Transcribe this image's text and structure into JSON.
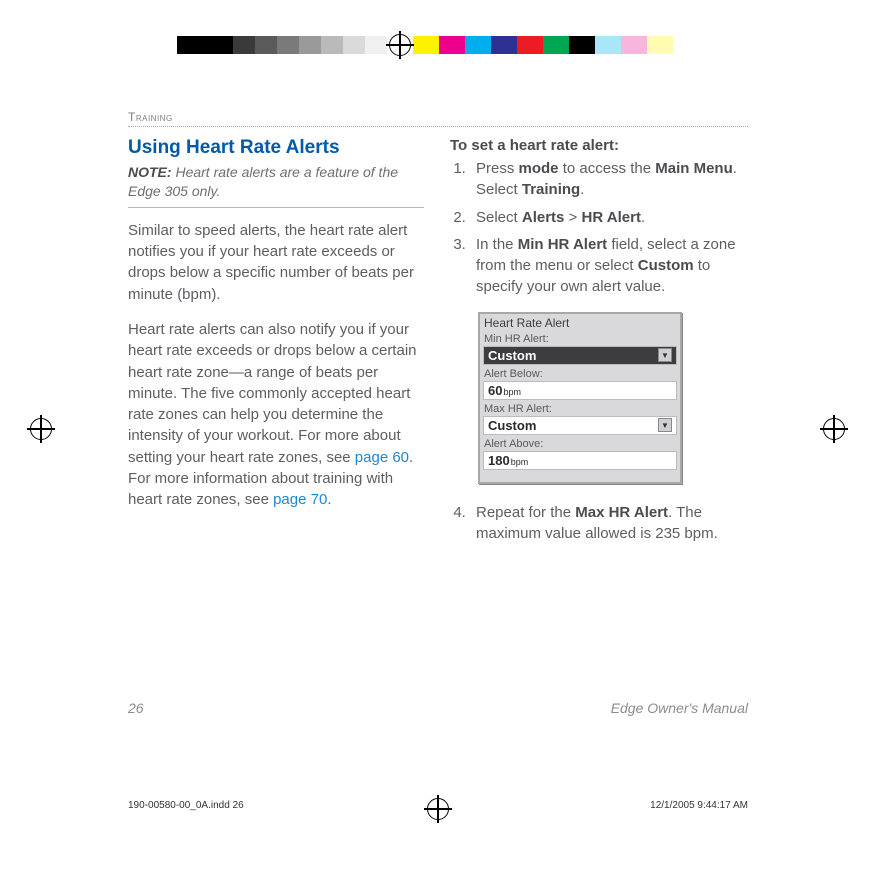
{
  "chapter": "Training",
  "heading": "Using Heart Rate Alerts",
  "note_label": "NOTE:",
  "note_text": " Heart rate alerts are a feature of the Edge 305 only.",
  "para1": "Similar to speed alerts, the heart rate alert notifies you if your heart rate exceeds or drops below a specific number of beats per minute (bpm).",
  "para2a": "Heart rate alerts can also notify you if your heart rate exceeds or drops below a certain heart rate zone—a range of beats per minute. The five commonly accepted heart rate zones can help you determine the intensity of your workout. For more about setting your heart rate zones, see ",
  "link1": "page 60",
  "para2b": ". For more information about training with heart rate zones, see ",
  "link2": "page 70",
  "para2c": ".",
  "subhead": "To set a heart rate alert:",
  "steps": {
    "s1a": "Press ",
    "s1b": "mode",
    "s1c": " to access the ",
    "s1d": "Main Menu",
    "s1e": ". Select ",
    "s1f": "Training",
    "s1g": ".",
    "s2a": "Select ",
    "s2b": "Alerts",
    "s2c": " > ",
    "s2d": "HR Alert",
    "s2e": ".",
    "s3a": "In the ",
    "s3b": "Min HR Alert",
    "s3c": " field, select a zone from the menu or select ",
    "s3d": "Custom",
    "s3e": " to specify your own alert value.",
    "s4a": "Repeat for the ",
    "s4b": "Max HR Alert",
    "s4c": ". The maximum value allowed is 235 bpm."
  },
  "device": {
    "title": "Heart Rate Alert",
    "l1": "Min HR Alert:",
    "v1": "Custom",
    "l2": "Alert Below:",
    "v2": "60",
    "u2": "bpm",
    "l3": "Max HR Alert:",
    "v3": "Custom",
    "l4": "Alert Above:",
    "v4": "180",
    "u4": "bpm"
  },
  "footer": {
    "page": "26",
    "doc": "Edge Owner's Manual"
  },
  "prepress": {
    "file": "190-00580-00_0A.indd   26",
    "stamp": "12/1/2005   9:44:17 AM"
  }
}
